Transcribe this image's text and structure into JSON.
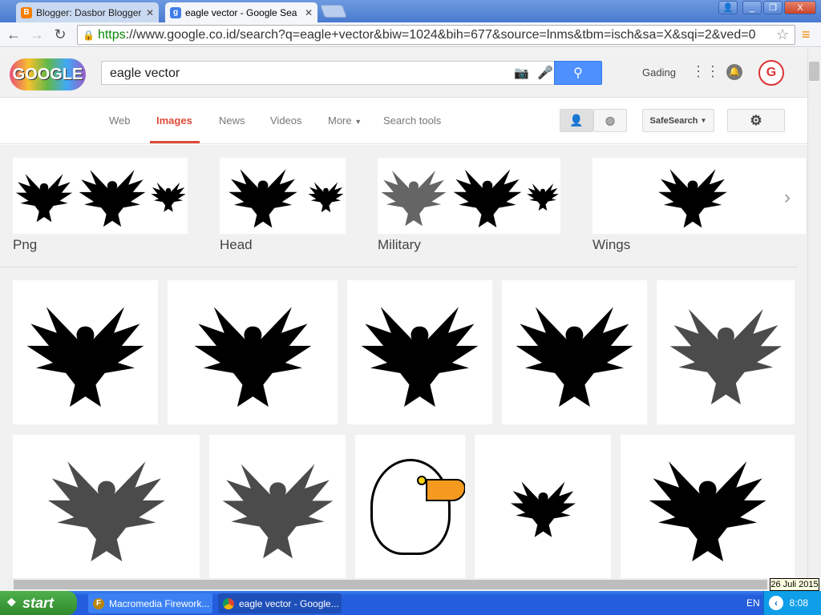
{
  "browser": {
    "tabs": [
      {
        "title": "Blogger: Dasbor Blogger",
        "icon": "blogger-icon"
      },
      {
        "title": "eagle vector - Google Search",
        "icon": "google-icon"
      }
    ],
    "url_scheme": "https",
    "url_rest": "://www.google.co.id/search?q=eagle+vector&biw=1024&bih=677&source=lnms&tbm=isch&sa=X&sqi=2&ved=0",
    "window_buttons": {
      "user": "👤",
      "minimize": "_",
      "restore": "❐",
      "close": "X"
    }
  },
  "google": {
    "logo": "GOOGLE",
    "query": "eagle vector",
    "user_name": "Gading",
    "nav": [
      "Web",
      "Images",
      "News",
      "Videos",
      "More",
      "Search tools"
    ],
    "active_nav": "Images",
    "safesearch": "SafeSearch"
  },
  "related": [
    {
      "label": "Png"
    },
    {
      "label": "Head"
    },
    {
      "label": "Military"
    },
    {
      "label": "Wings"
    }
  ],
  "taskbar": {
    "start": "start",
    "tasks": [
      "Macromedia Firework...",
      "eagle vector - Google..."
    ],
    "lang": "EN",
    "time": "8:08",
    "date_tooltip": "26 Juli 2015"
  },
  "colors": {
    "accent": "#dd4b39",
    "search_button": "#4d90fe",
    "taskbar": "#245edc"
  }
}
